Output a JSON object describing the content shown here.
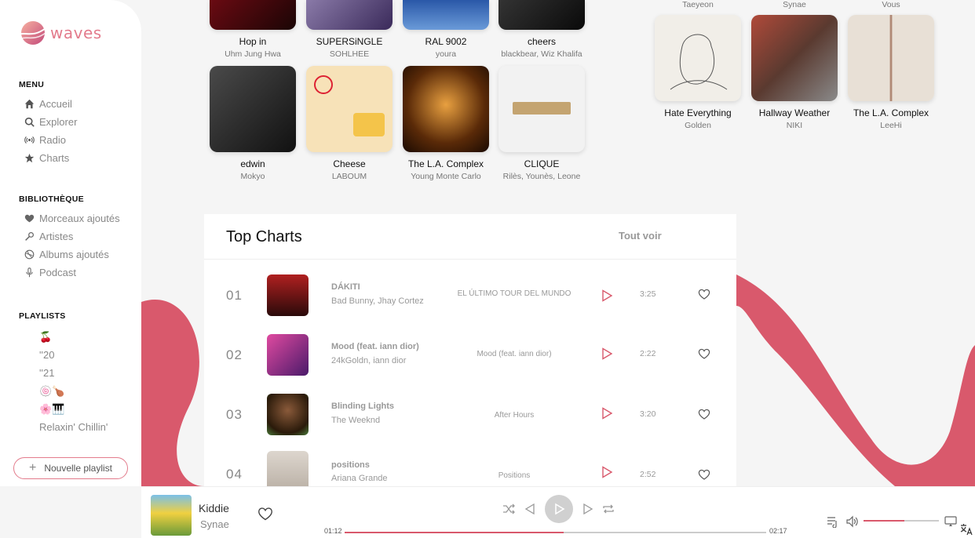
{
  "app": {
    "name": "waves"
  },
  "sidebar": {
    "menu_title": "MENU",
    "menu": [
      {
        "label": "Accueil",
        "icon": "home-icon"
      },
      {
        "label": "Explorer",
        "icon": "search-icon"
      },
      {
        "label": "Radio",
        "icon": "radio-icon"
      },
      {
        "label": "Charts",
        "icon": "star-icon"
      }
    ],
    "library_title": "BIBLIOTHÈQUE",
    "library": [
      {
        "label": "Morceaux ajoutés",
        "icon": "heart-icon"
      },
      {
        "label": "Artistes",
        "icon": "microphone-icon"
      },
      {
        "label": "Albums ajoutés",
        "icon": "disc-icon"
      },
      {
        "label": "Podcast",
        "icon": "podcast-mic-icon"
      }
    ],
    "playlists_title": "PLAYLISTS",
    "playlists": [
      {
        "label": "🍒"
      },
      {
        "label": "''20"
      },
      {
        "label": "''21"
      },
      {
        "label": "🍥🍗"
      },
      {
        "label": "🌸🎹"
      },
      {
        "label": "Relaxin' Chillin'"
      }
    ],
    "new_playlist": "Nouvelle playlist"
  },
  "albums_left": [
    {
      "title": "Hop in",
      "artist": "Uhm Jung Hwa",
      "color": "#3a0a0a"
    },
    {
      "title": "SUPERSiNGLE",
      "artist": "SOHLHEE",
      "color": "#6a5a8a"
    },
    {
      "title": "RAL 9002",
      "artist": "youra",
      "color": "#3b6fb5"
    },
    {
      "title": "cheers",
      "artist": "blackbear, Wiz Khalifa",
      "color": "#1a1a1a"
    },
    {
      "title": "edwin",
      "artist": "Mokyo",
      "color": "#2a2a2a"
    },
    {
      "title": "Cheese",
      "artist": "LABOUM",
      "color": "#f7e2b8"
    },
    {
      "title": "The L.A. Complex",
      "artist": "Young Monte Carlo",
      "color": "#6a3a10"
    },
    {
      "title": "CLIQUE",
      "artist": "Rilès, Younès, Leone",
      "color": "#f2f2f2"
    }
  ],
  "albums_right_top_artists": [
    "Taeyeon",
    "Synae",
    "Vous"
  ],
  "albums_right": [
    {
      "title": "Hate Everything",
      "artist": "Golden",
      "color": "#f1eee8"
    },
    {
      "title": "Hallway Weather",
      "artist": "NIKI",
      "color": "#8a4a40"
    },
    {
      "title": "The L.A. Complex",
      "artist": "LeeHi",
      "color": "#d9cfc3"
    }
  ],
  "charts": {
    "title": "Top Charts",
    "see_all": "Tout voir",
    "rows": [
      {
        "rank": "01",
        "title": "DÁKITI",
        "artist": "Bad Bunny, Jhay Cortez",
        "album": "EL ÚLTIMO TOUR DEL MUNDO",
        "duration": "3:25",
        "color": "#8a1a1a"
      },
      {
        "rank": "02",
        "title": "Mood (feat. iann dior)",
        "artist": "24kGoldn, iann dior",
        "album": "Mood (feat. iann dior)",
        "duration": "2:22",
        "color": "#c23a8a"
      },
      {
        "rank": "03",
        "title": "Blinding Lights",
        "artist": "The Weeknd",
        "album": "After Hours",
        "duration": "3:20",
        "color": "#5a2a1a"
      },
      {
        "rank": "04",
        "title": "positions",
        "artist": "Ariana Grande",
        "album": "Positions",
        "duration": "2:52",
        "color": "#cfc6bd"
      }
    ]
  },
  "player": {
    "title": "Kiddie",
    "artist": "Synae",
    "elapsed": "01:12",
    "total": "02:17",
    "progress": 0.52,
    "volume": 0.54
  },
  "colors": {
    "accent": "#d9596c",
    "ribbon": "#d9596c"
  }
}
